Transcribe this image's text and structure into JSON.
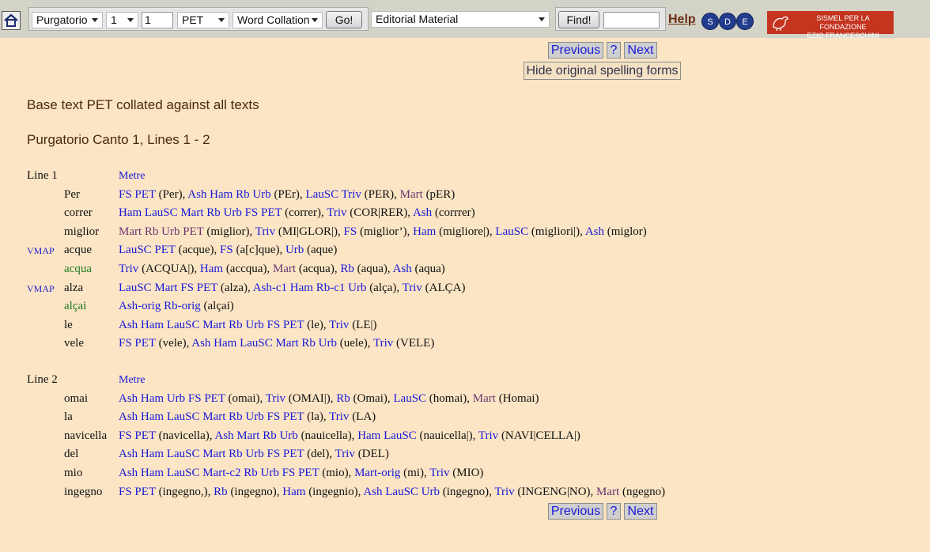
{
  "toolbar": {
    "cantica_select": "Purgatorio",
    "canto_select": "1",
    "line_input": "1",
    "base_text_select": "PET",
    "view_select": "Word Collation",
    "go_label": "Go!",
    "material_select": "Editorial Material",
    "find_label": "Find!",
    "find_input": "",
    "help_label": "Help",
    "sde": [
      "S",
      "D",
      "E"
    ],
    "sismel_line1": "SISMEL PER LA FONDAZIONE",
    "sismel_line2": "EZIO FRANCESCHINI"
  },
  "nav": {
    "previous_label": "Previous",
    "question_label": "?",
    "next_label": "Next",
    "hide_label": "Hide original spelling forms"
  },
  "heading": {
    "collation": "Base text PET collated against all texts",
    "location": "Purgatorio Canto 1, Lines 1 - 2"
  },
  "lines": [
    {
      "label": "Line 1",
      "metre_label": "Metre",
      "words": [
        {
          "vmap": "",
          "word": "Per",
          "variant": false,
          "readings": [
            [
              "FS PET",
              " (Per), "
            ],
            [
              "Ash Ham Rb Urb",
              " (PEr), "
            ],
            [
              "LauSC Triv",
              " (PER), "
            ],
            [
              "Mart",
              " (pER)"
            ]
          ]
        },
        {
          "vmap": "",
          "word": "correr",
          "variant": false,
          "readings": [
            [
              "Ham LauSC Mart Rb Urb FS PET",
              " (correr), "
            ],
            [
              "Triv",
              " (COR|RER), "
            ],
            [
              "Ash",
              " (corrrer)"
            ]
          ]
        },
        {
          "vmap": "",
          "word": "miglior",
          "variant": false,
          "readings": [
            [
              "Mart Rb Urb PET",
              " (miglior), "
            ],
            [
              "Triv",
              " (MI|GLOR|), "
            ],
            [
              "FS",
              " (miglior’), "
            ],
            [
              "Ham",
              " (migliore|), "
            ],
            [
              "LauSC",
              " (migliori|), "
            ],
            [
              "Ash",
              " (miglor)"
            ]
          ]
        },
        {
          "vmap": "VMAP",
          "word": "acque",
          "variant": false,
          "readings": [
            [
              "LauSC PET",
              " (acque), "
            ],
            [
              "FS",
              " (a[c]que), "
            ],
            [
              "Urb",
              " (aque)"
            ]
          ]
        },
        {
          "vmap": "",
          "word": "acqua",
          "variant": true,
          "readings": [
            [
              "Triv",
              " (ACQUA|), "
            ],
            [
              "Ham",
              " (accqua), "
            ],
            [
              "Mart",
              " (acqua), "
            ],
            [
              "Rb",
              " (aqua), "
            ],
            [
              "Ash",
              " (aqua)"
            ]
          ]
        },
        {
          "vmap": "VMAP",
          "word": "alza",
          "variant": false,
          "readings": [
            [
              "LauSC Mart FS PET",
              " (alza), "
            ],
            [
              "Ash-c1 Ham Rb-c1 Urb",
              " (alça), "
            ],
            [
              "Triv",
              " (ALÇA)"
            ]
          ]
        },
        {
          "vmap": "",
          "word": "alçai",
          "variant": true,
          "readings": [
            [
              "Ash-orig Rb-orig",
              " (alçai)"
            ]
          ]
        },
        {
          "vmap": "",
          "word": "le",
          "variant": false,
          "readings": [
            [
              "Ash Ham LauSC Mart Rb Urb FS PET",
              " (le), "
            ],
            [
              "Triv",
              " (LE|)"
            ]
          ]
        },
        {
          "vmap": "",
          "word": "vele",
          "variant": false,
          "readings": [
            [
              "FS PET",
              " (vele), "
            ],
            [
              "Ash Ham LauSC Mart Rb Urb",
              " (uele), "
            ],
            [
              "Triv",
              " (VELE)"
            ]
          ]
        }
      ]
    },
    {
      "label": "Line 2",
      "metre_label": "Metre",
      "words": [
        {
          "vmap": "",
          "word": "omai",
          "variant": false,
          "readings": [
            [
              "Ash Ham Urb FS PET",
              " (omai), "
            ],
            [
              "Triv",
              " (OMAI|), "
            ],
            [
              "Rb",
              " (Omai), "
            ],
            [
              "LauSC",
              " (homai), "
            ],
            [
              "Mart",
              " (Homai)"
            ]
          ]
        },
        {
          "vmap": "",
          "word": "la",
          "variant": false,
          "readings": [
            [
              "Ash Ham LauSC Mart Rb Urb FS PET",
              " (la), "
            ],
            [
              "Triv",
              " (LA)"
            ]
          ]
        },
        {
          "vmap": "",
          "word": "navicella",
          "variant": false,
          "readings": [
            [
              "FS PET",
              " (navicella), "
            ],
            [
              "Ash Mart Rb Urb",
              " (nauicella), "
            ],
            [
              "Ham LauSC",
              " (nauicella|), "
            ],
            [
              "Triv",
              " (NAVI|CELLA|)"
            ]
          ]
        },
        {
          "vmap": "",
          "word": "del",
          "variant": false,
          "readings": [
            [
              "Ash Ham LauSC Mart Rb Urb FS PET",
              " (del), "
            ],
            [
              "Triv",
              " (DEL)"
            ]
          ]
        },
        {
          "vmap": "",
          "word": "mio",
          "variant": false,
          "readings": [
            [
              "Ash Ham LauSC Mart-c2 Rb Urb FS PET",
              " (mio), "
            ],
            [
              "Mart-orig",
              " (mi), "
            ],
            [
              "Triv",
              " (MIO)"
            ]
          ]
        },
        {
          "vmap": "",
          "word": "ingegno",
          "variant": false,
          "readings": [
            [
              "FS PET",
              " (ingegno,), "
            ],
            [
              "Rb",
              " (ingegno), "
            ],
            [
              "Ham",
              " (ingegnio), "
            ],
            [
              "Ash LauSC Urb",
              " (ingegno), "
            ],
            [
              "Triv",
              " (INGENG|NO), "
            ],
            [
              "Mart",
              " (ngegno)"
            ]
          ]
        }
      ]
    }
  ]
}
